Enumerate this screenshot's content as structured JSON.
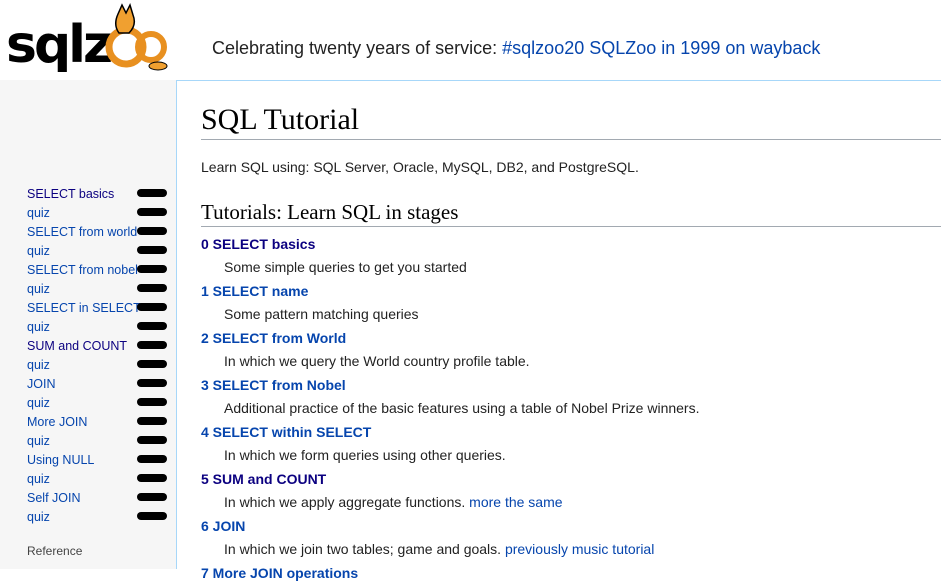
{
  "header": {
    "banner_text": "Celebrating twenty years of service:",
    "banner_links": [
      "#sqlzoo20",
      "SQLZoo in 1999 on wayback"
    ]
  },
  "logo": {
    "text": "sqlzoo",
    "colors": {
      "text": "#000000",
      "accent": "#f0a030"
    }
  },
  "sidebar": {
    "items": [
      {
        "label": "SELECT basics",
        "visited": true
      },
      {
        "label": "quiz"
      },
      {
        "label": "SELECT from world"
      },
      {
        "label": "quiz"
      },
      {
        "label": "SELECT from nobel"
      },
      {
        "label": "quiz"
      },
      {
        "label": "SELECT in SELECT"
      },
      {
        "label": "quiz"
      },
      {
        "label": "SUM and COUNT",
        "visited": true
      },
      {
        "label": "quiz"
      },
      {
        "label": "JOIN"
      },
      {
        "label": "quiz"
      },
      {
        "label": "More JOIN"
      },
      {
        "label": "quiz"
      },
      {
        "label": "Using NULL"
      },
      {
        "label": "quiz"
      },
      {
        "label": "Self JOIN"
      },
      {
        "label": "quiz"
      }
    ],
    "reference_label": "Reference"
  },
  "main": {
    "title": "SQL Tutorial",
    "intro": "Learn SQL using: SQL Server, Oracle, MySQL, DB2, and PostgreSQL.",
    "section_title": "Tutorials: Learn SQL in stages",
    "tutorials": [
      {
        "title": "0 SELECT basics",
        "desc": "Some simple queries to get you started",
        "visited": true
      },
      {
        "title": "1 SELECT name",
        "desc": "Some pattern matching queries"
      },
      {
        "title": "2 SELECT from World",
        "desc": "In which we query the World country profile table."
      },
      {
        "title": "3 SELECT from Nobel",
        "desc": "Additional practice of the basic features using a table of Nobel Prize winners."
      },
      {
        "title": "4 SELECT within SELECT",
        "desc": "In which we form queries using other queries."
      },
      {
        "title": "5 SUM and COUNT",
        "desc": "In which we apply aggregate functions.",
        "link": "more the same",
        "visited": true
      },
      {
        "title": "6 JOIN",
        "desc": "In which we join two tables; game and goals.",
        "link": "previously music tutorial"
      },
      {
        "title": "7 More JOIN operations"
      }
    ]
  },
  "colors": {
    "link": "#0645ad",
    "visited": "#0b0080",
    "border": "#a7d7f9"
  }
}
